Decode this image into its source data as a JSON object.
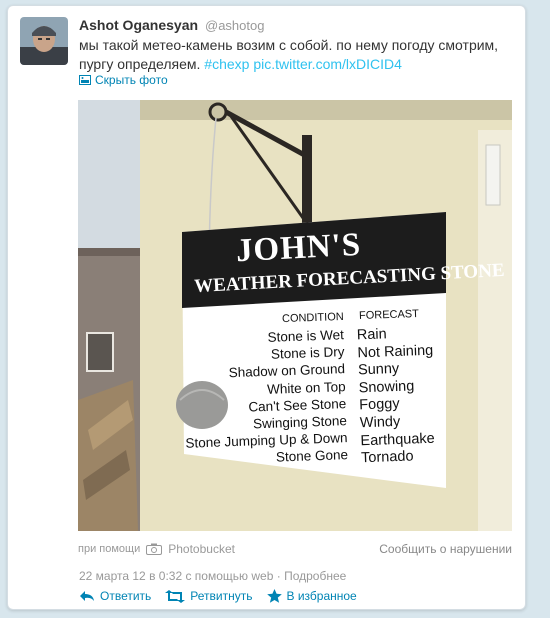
{
  "tweet": {
    "author_name": "Ashot Oganesyan",
    "author_handle": "@ashotog",
    "text_plain": "мы такой метео-камень возим с собой. по нему погоду смотрим, пургу определяем. ",
    "hashtag": "#chexp",
    "pic_link": "pic.twitter.com/lxDICID4",
    "photo_toggle_label": "Скрыть фото"
  },
  "sign": {
    "title": "JOHN'S",
    "subtitle": "WEATHER FORECASTING STONE",
    "col_condition": "CONDITION",
    "col_forecast": "FORECAST",
    "conditions": [
      "Stone is Wet",
      "Stone is Dry",
      "Shadow on Ground",
      "White on Top",
      "Can't See Stone",
      "Swinging Stone",
      "Stone Jumping Up & Down",
      "Stone Gone"
    ],
    "forecasts": [
      "Rain",
      "Not Raining",
      "Sunny",
      "Snowing",
      "Foggy",
      "Windy",
      "Earthquake",
      "Tornado"
    ]
  },
  "attribution": {
    "via_label": "при помощи",
    "service": "Photobucket",
    "report_label": "Сообщить о нарушении"
  },
  "meta": {
    "timestamp": "22 марта 12 в 0:32",
    "via": " с помощью ",
    "client": "web",
    "separator": " · ",
    "details": "Подробнее"
  },
  "actions": {
    "reply": "Ответить",
    "retweet": "Ретвитнуть",
    "favorite": "В избранное"
  },
  "colors": {
    "link": "#2fc2ef",
    "action": "#0084b4",
    "background": "#d8e6ed"
  }
}
